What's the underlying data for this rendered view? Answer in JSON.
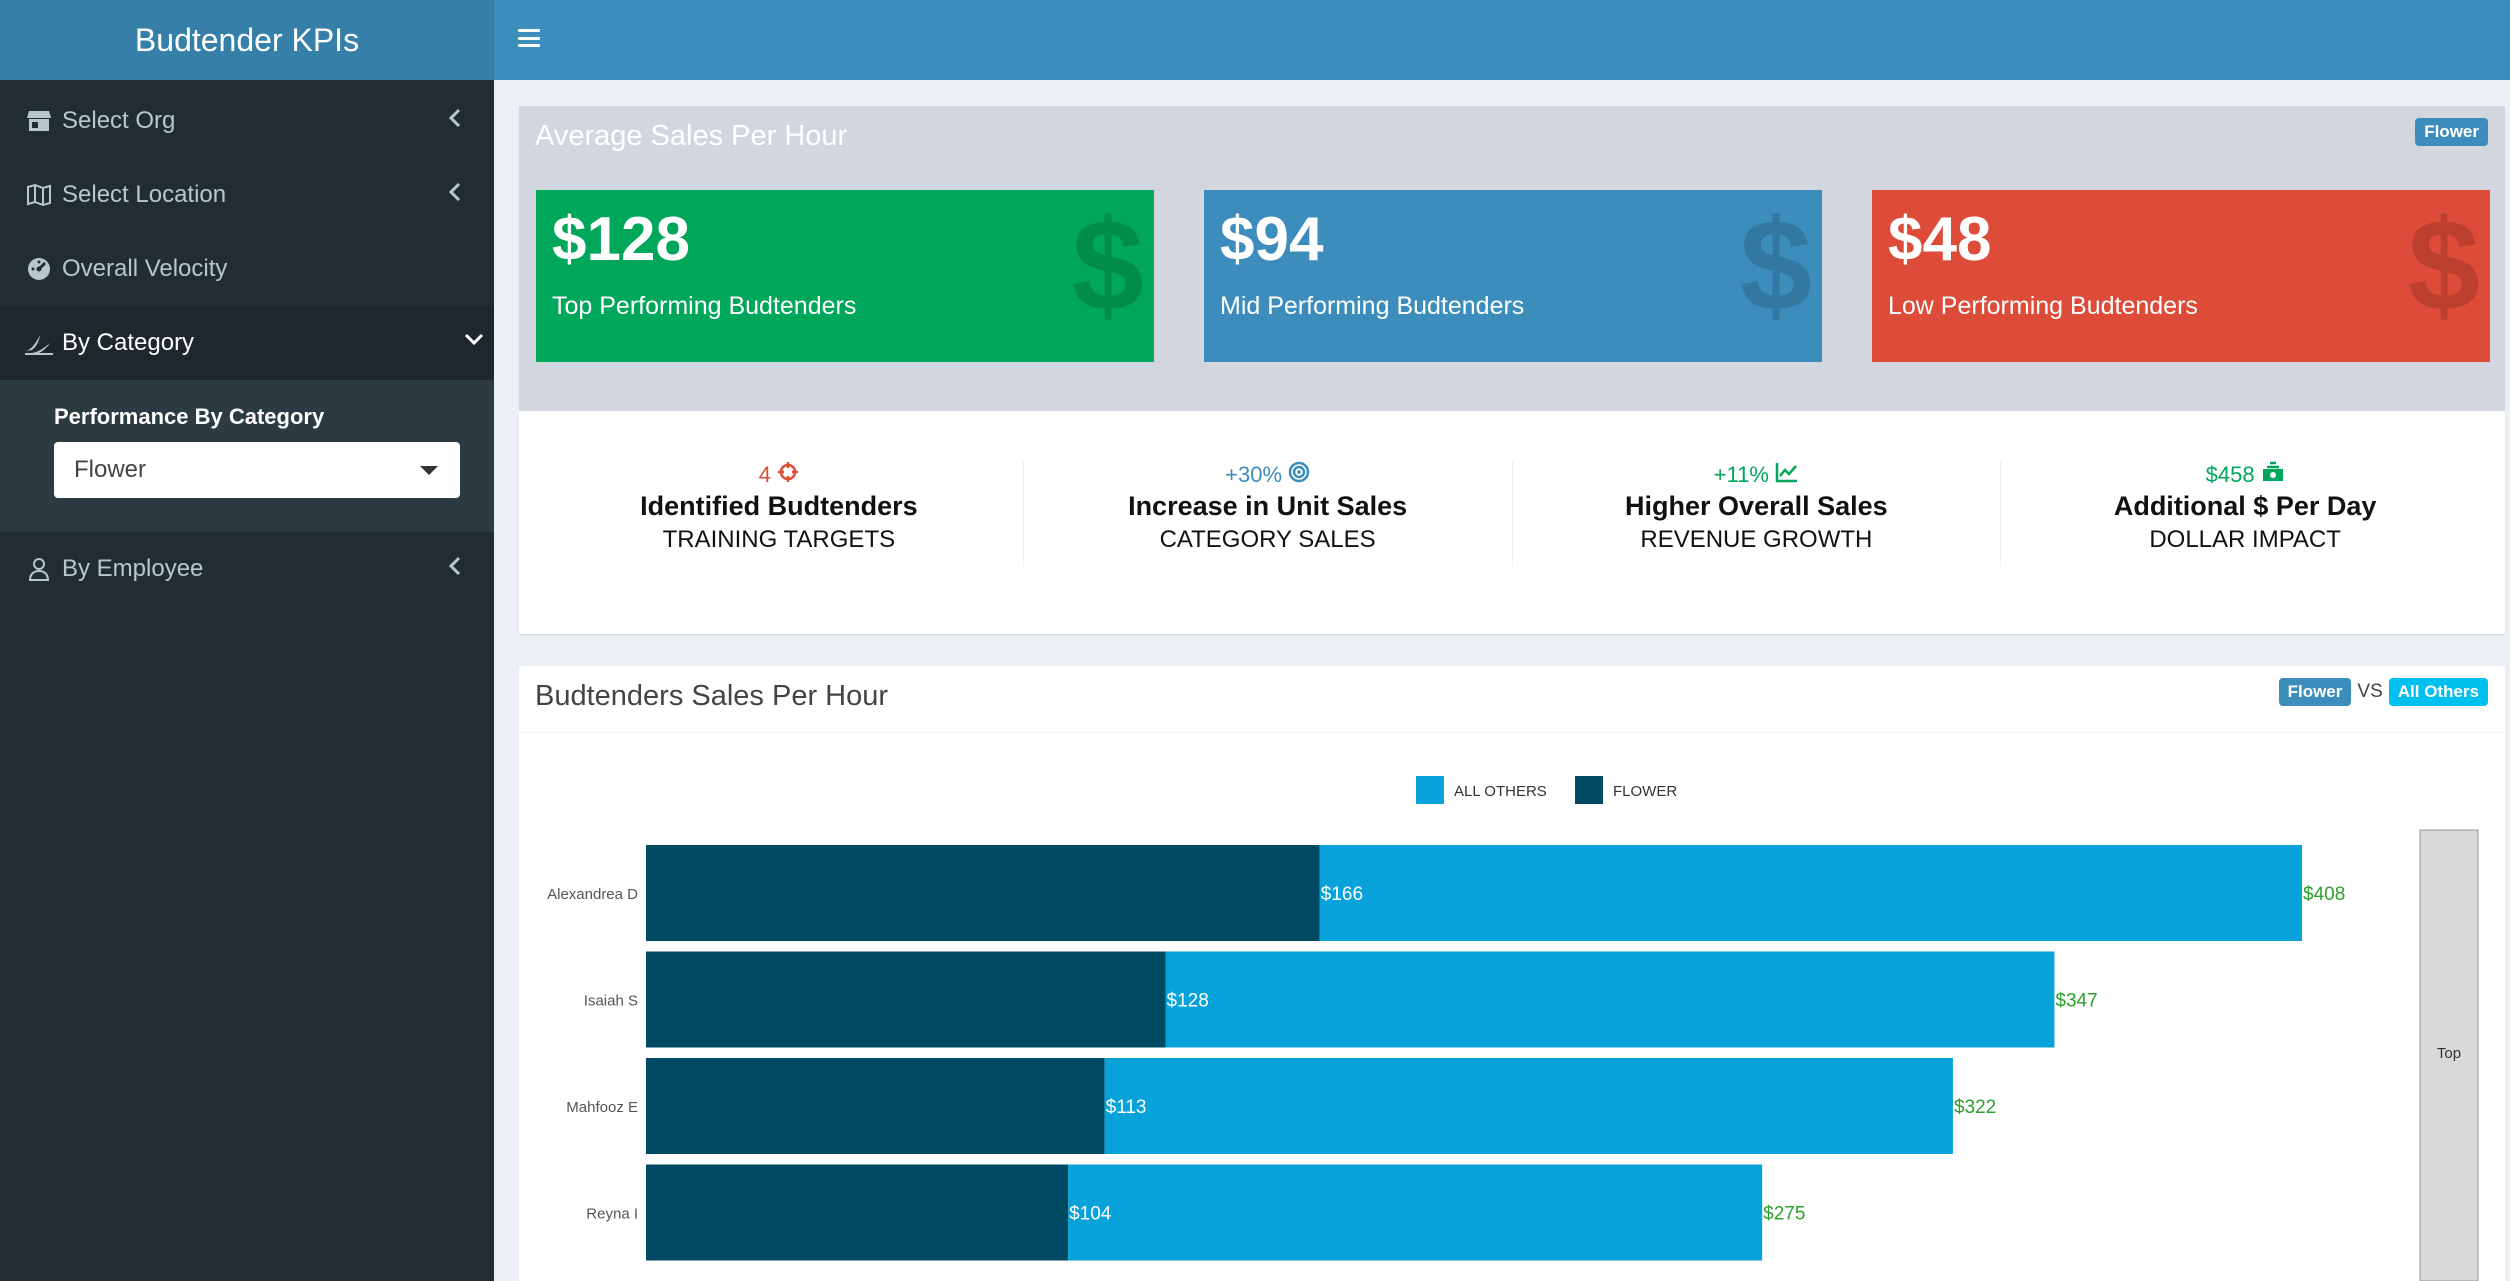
{
  "sidebar": {
    "title": "Budtender KPIs",
    "items": [
      {
        "label": "Select Org"
      },
      {
        "label": "Select Location"
      },
      {
        "label": "Overall Velocity"
      },
      {
        "label": "By Category"
      },
      {
        "label": "By Employee"
      }
    ],
    "submenu_label": "Performance By Category",
    "select_value": "Flower"
  },
  "box1": {
    "title": "Average Sales Per Hour",
    "badge": "Flower",
    "cards": [
      {
        "value": "$128",
        "label": "Top Performing Budtenders",
        "color": "#00a65a"
      },
      {
        "value": "$94",
        "label": "Mid Performing Budtenders",
        "color": "#3c8dbc"
      },
      {
        "value": "$48",
        "label": "Low Performing Budtenders",
        "color": "#dd4b39"
      }
    ],
    "card_icon": "$",
    "kpis": [
      {
        "stat": "4",
        "icon": "crosshairs-icon",
        "headline": "Identified Budtenders",
        "sub": "TRAINING TARGETS",
        "color": "#dd4b39"
      },
      {
        "stat": "+30%",
        "icon": "bullseye-icon",
        "headline": "Increase in Unit Sales",
        "sub": "CATEGORY SALES",
        "color": "#3c8dbc"
      },
      {
        "stat": "+11%",
        "icon": "line-chart-icon",
        "headline": "Higher Overall Sales",
        "sub": "REVENUE GROWTH",
        "color": "#00a65a"
      },
      {
        "stat": "$458",
        "icon": "money-icon",
        "headline": "Additional $ Per Day",
        "sub": "DOLLAR IMPACT",
        "color": "#00a65a"
      }
    ]
  },
  "box2": {
    "title": "Budtenders Sales Per Hour",
    "badge_left": "Flower",
    "vs": "VS",
    "badge_right": "All Others",
    "top_label": "Top"
  },
  "chart_data": {
    "type": "bar",
    "orientation": "horizontal",
    "stacked": true,
    "categories": [
      "Alexandrea D",
      "Isaiah S",
      "Mahfooz E",
      "Reyna I"
    ],
    "series": [
      {
        "name": "FLOWER",
        "values": [
          166,
          128,
          113,
          104
        ],
        "color": "#004a63",
        "labels": [
          "$166",
          "$128",
          "$113",
          "$104"
        ]
      },
      {
        "name": "ALL OTHERS",
        "values": [
          242,
          219,
          209,
          171
        ],
        "color": "#06a2d9"
      }
    ],
    "totals": [
      408,
      347,
      322,
      275
    ],
    "total_labels": [
      "$408",
      "$347",
      "$322",
      "$275"
    ],
    "legend": [
      {
        "name": "ALL OTHERS",
        "color": "#06a2d9"
      },
      {
        "name": "FLOWER",
        "color": "#004a63"
      }
    ],
    "legend_position": "top",
    "xlim": [
      0,
      408
    ]
  }
}
